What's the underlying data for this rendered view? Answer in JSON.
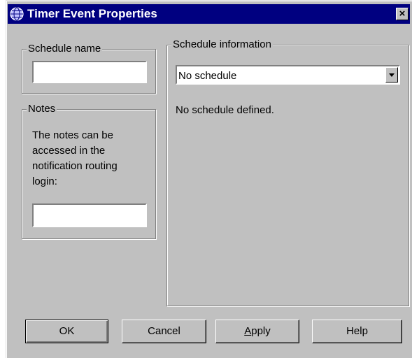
{
  "window": {
    "title": "Timer Event Properties",
    "close_label": "×"
  },
  "schedule_name": {
    "label": "Schedule name",
    "value": ""
  },
  "notes": {
    "label": "Notes",
    "description": "The notes can be accessed in the notification routing login:",
    "value": ""
  },
  "schedule_information": {
    "label": "Schedule information",
    "selected": "No schedule",
    "status": "No schedule defined."
  },
  "buttons": {
    "ok": "OK",
    "cancel": "Cancel",
    "apply": "Apply",
    "help": "Help"
  },
  "colors": {
    "titlebar": "#000080",
    "face": "#c0c0c0"
  }
}
